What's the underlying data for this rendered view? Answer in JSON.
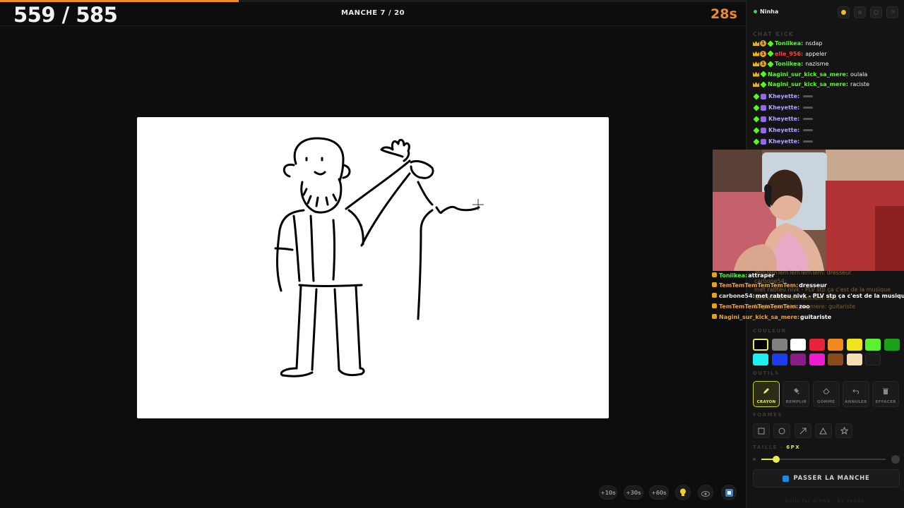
{
  "game": {
    "score": "559 / 585",
    "round": "MANCHE 7 / 20",
    "timer": "28s",
    "progress": 0.32
  },
  "bottom_bar": {
    "add10": "+10s",
    "add30": "+30s",
    "add60": "+60s",
    "icons": [
      "bulb-icon",
      "eye-icon",
      "stop-icon"
    ]
  },
  "panel": {
    "user": "Ninha",
    "chat_title": "CHAT KICK",
    "chat": [
      {
        "user": "Toniikea:",
        "msg": "nsdap",
        "color": "#53fc18",
        "badges": [
          "crown",
          "num",
          "gem"
        ]
      },
      {
        "user": "elle_956:",
        "msg": "appeler",
        "color": "#ff3b3b",
        "badges": [
          "crown",
          "num",
          "gem"
        ]
      },
      {
        "user": "Toniikea:",
        "msg": "nazisme",
        "color": "#53fc18",
        "badges": [
          "crown",
          "num",
          "gem"
        ]
      },
      {
        "user": "Nagini_sur_kick_sa_mere:",
        "msg": "oulala",
        "color": "#53fc18",
        "badges": [
          "crown",
          "gem"
        ]
      },
      {
        "user": "Nagini_sur_kick_sa_mere:",
        "msg": "raciste",
        "color": "#53fc18",
        "badges": [
          "crown",
          "gem"
        ]
      },
      {
        "user": "Kheyette:",
        "msg": "",
        "color": "#b9a4ff",
        "badges": [
          "gem",
          "cube"
        ]
      },
      {
        "user": "Kheyette:",
        "msg": "",
        "color": "#b9a4ff",
        "badges": [
          "gem",
          "cube"
        ]
      },
      {
        "user": "Kheyette:",
        "msg": "",
        "color": "#b9a4ff",
        "badges": [
          "gem",
          "cube"
        ]
      },
      {
        "user": "Kheyette:",
        "msg": "",
        "color": "#b9a4ff",
        "badges": [
          "gem",
          "cube"
        ]
      },
      {
        "user": "Kheyette:",
        "msg": "",
        "color": "#b9a4ff",
        "badges": [
          "gem",
          "cube"
        ]
      }
    ],
    "overlay_chat": [
      {
        "user": "Toniikea:",
        "msg": "attraper",
        "color": "#53fc18"
      },
      {
        "user": "TemTemTemTemTemTem:",
        "msg": "dresseur",
        "color": "#f0a030"
      },
      {
        "user": "carbone54:",
        "msg": "met rabteu nivk - PLV stp ça c'est de la musique",
        "color": "#e0e0e0"
      },
      {
        "user": "TemTemTemTemTemTem:",
        "msg": "zoo",
        "color": "#f0a030"
      },
      {
        "user": "Nagini_sur_kick_sa_mere:",
        "msg": "guitariste",
        "color": "#f0a030"
      }
    ],
    "overlay_ghost": [
      {
        "text": "TemTemTemTemTemTem: dresseur"
      },
      {
        "text": "carbone54:"
      },
      {
        "text": "met rabteu nivk - PLV stp ça c'est de la musique"
      },
      {
        "text": "TemTemTemTemTemTem: zoo"
      },
      {
        "text": "Nagini_sur_kick_sa_mere: guitariste"
      }
    ],
    "color_label": "COULEUR",
    "colors": [
      "#000000",
      "#808080",
      "#ffffff",
      "#e8243c",
      "#f08a1c",
      "#f2e41c",
      "#5cf032",
      "#1ca01c",
      "#1cf0f0",
      "#1c3cf0",
      "#8a1c8a",
      "#f01cd2",
      "#8a4a1c",
      "#f5deb3",
      "#1b1b1b"
    ],
    "selected_color": "#000000",
    "tools_label": "OUTILS",
    "tools": [
      {
        "label": "CRAYON",
        "icon": "pencil-icon",
        "active": true
      },
      {
        "label": "REMPLIR",
        "icon": "fill-bucket-icon",
        "active": false
      },
      {
        "label": "GOMME",
        "icon": "eraser-icon",
        "active": false
      },
      {
        "label": "ANNULER",
        "icon": "undo-icon",
        "active": false
      },
      {
        "label": "EFFACER",
        "icon": "trash-icon",
        "active": false
      }
    ],
    "shapes_label": "FORMES",
    "shapes": [
      "square-icon",
      "circle-icon",
      "arrow-icon",
      "triangle-icon",
      "star-icon"
    ],
    "size_label": "TAILLE -",
    "size_value": "6PX",
    "size_fraction": 0.12,
    "skip_button": "PASSER LA MANCHE",
    "footer": "built for ninha · by teddo"
  }
}
